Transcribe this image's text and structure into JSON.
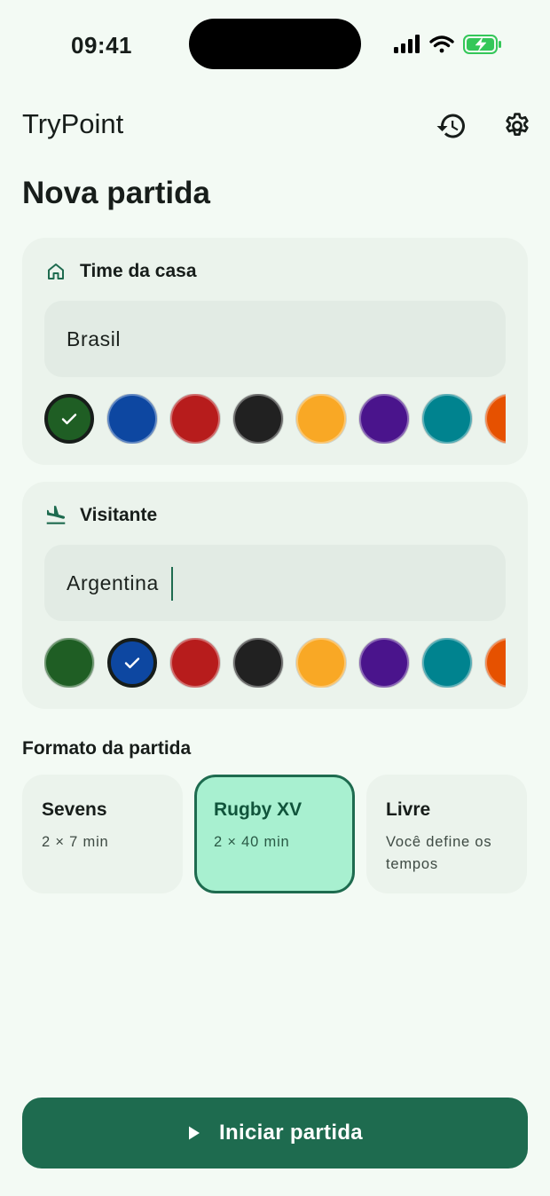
{
  "status_bar": {
    "time": "09:41"
  },
  "app_bar": {
    "title": "TryPoint",
    "history_icon": "history-icon",
    "settings_icon": "gear-icon"
  },
  "page": {
    "title": "Nova partida"
  },
  "home_team": {
    "label": "Time da casa",
    "icon": "home-icon",
    "name_value": "Brasil",
    "selected_color": "#1f5e24",
    "colors": [
      "#1f5e24",
      "#0d47a1",
      "#b71c1c",
      "#212121",
      "#f9a825",
      "#4a148c",
      "#00838f",
      "#e65100"
    ]
  },
  "away_team": {
    "label": "Visitante",
    "icon": "flight-land-icon",
    "name_value": "Argentina",
    "selected_color": "#0d47a1",
    "colors": [
      "#1f5e24",
      "#0d47a1",
      "#b71c1c",
      "#212121",
      "#f9a825",
      "#4a148c",
      "#00838f",
      "#e65100"
    ]
  },
  "format": {
    "label": "Formato da partida",
    "selected": "Rugby XV",
    "options": [
      {
        "name": "Sevens",
        "desc": "2 × 7 min"
      },
      {
        "name": "Rugby XV",
        "desc": "2 × 40 min"
      },
      {
        "name": "Livre",
        "desc": "Você define os tempos"
      }
    ]
  },
  "start_button": {
    "label": "Iniciar partida",
    "icon": "play-icon"
  },
  "theme": {
    "accent": "#1e6b4f",
    "background": "#f3faf4",
    "card": "#ebf3ec",
    "selected_card": "#a8f0d0"
  }
}
